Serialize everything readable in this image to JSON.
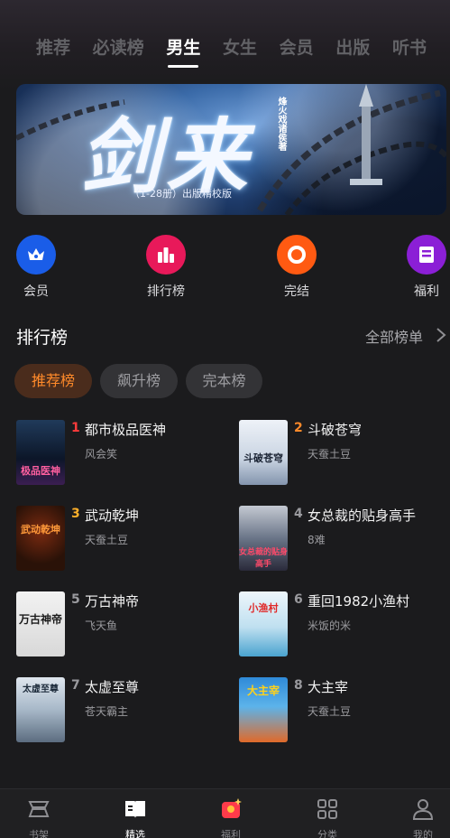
{
  "tabs": [
    {
      "label": "推荐",
      "active": false
    },
    {
      "label": "必读榜",
      "active": false
    },
    {
      "label": "男生",
      "active": true
    },
    {
      "label": "女生",
      "active": false
    },
    {
      "label": "会员",
      "active": false
    },
    {
      "label": "出版",
      "active": false
    },
    {
      "label": "听书",
      "active": false
    }
  ],
  "banner": {
    "title": "剑来",
    "author": "烽火戏诸侯著",
    "subtitle": "（1-28册）出版精校版"
  },
  "quick_entries": [
    {
      "label": "会员",
      "icon": "crown-icon",
      "color": "#1a5de8"
    },
    {
      "label": "排行榜",
      "icon": "bar-chart-icon",
      "color": "#e8195a"
    },
    {
      "label": "完结",
      "icon": "ring-icon",
      "color": "#ff5a12"
    },
    {
      "label": "福利",
      "icon": "card-icon",
      "color": "#8b1fd6"
    }
  ],
  "ranking": {
    "title": "排行榜",
    "all_label": "全部榜单",
    "chips": [
      {
        "label": "推荐榜",
        "active": true
      },
      {
        "label": "飙升榜",
        "active": false
      },
      {
        "label": "完本榜",
        "active": false
      }
    ],
    "books": [
      {
        "rank": "1",
        "title": "都市极品医神",
        "author": "风会笑",
        "cover_text": "极品医神",
        "rank_color": "#ff3b3b"
      },
      {
        "rank": "2",
        "title": "斗破苍穹",
        "author": "天蚕土豆",
        "cover_text": "斗破苍穹",
        "rank_color": "#ff8a2a"
      },
      {
        "rank": "3",
        "title": "武动乾坤",
        "author": "天蚕土豆",
        "cover_text": "武动乾坤",
        "rank_color": "#ffb02a"
      },
      {
        "rank": "4",
        "title": "女总裁的贴身高手",
        "author": "8难",
        "cover_text": "女总裁的贴身高手",
        "rank_color": "#9a9a9e"
      },
      {
        "rank": "5",
        "title": "万古神帝",
        "author": "飞天鱼",
        "cover_text": "万古神帝",
        "rank_color": "#9a9a9e"
      },
      {
        "rank": "6",
        "title": "重回1982小渔村",
        "author": "米饭的米",
        "cover_text": "小渔村",
        "rank_color": "#9a9a9e"
      },
      {
        "rank": "7",
        "title": "太虚至尊",
        "author": "苍天霸主",
        "cover_text": "太虚至尊",
        "rank_color": "#9a9a9e"
      },
      {
        "rank": "8",
        "title": "大主宰",
        "author": "天蚕土豆",
        "cover_text": "大主宰",
        "rank_color": "#9a9a9e"
      }
    ]
  },
  "bottom_nav": [
    {
      "label": "书架",
      "icon": "bookshelf-icon",
      "active": false
    },
    {
      "label": "精选",
      "icon": "featured-book-icon",
      "active": true
    },
    {
      "label": "福利",
      "icon": "gift-icon",
      "active": false
    },
    {
      "label": "分类",
      "icon": "grid-icon",
      "active": false
    },
    {
      "label": "我的",
      "icon": "person-icon",
      "active": false
    }
  ]
}
